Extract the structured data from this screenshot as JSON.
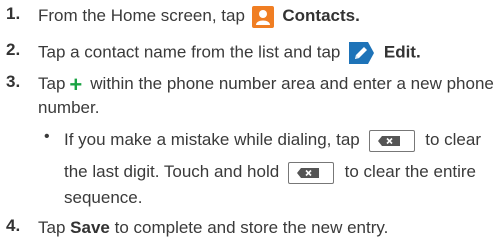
{
  "steps": [
    {
      "number": "1.",
      "text_before": "From the Home screen, tap",
      "bold_label": "Contacts",
      "text_after": "."
    },
    {
      "number": "2.",
      "text_before": "Tap a contact name from the list and tap",
      "bold_label": "Edit",
      "text_after": "."
    },
    {
      "number": "3.",
      "text_before": "Tap",
      "text_after_line1": "within the phone number area and enter a new phone",
      "text_line2": "number."
    },
    {
      "number": "4.",
      "text_before": "Tap",
      "bold_label": "Save",
      "text_after": "to complete and store the new entry."
    }
  ],
  "bullet": {
    "symbol": "•",
    "line1_before": "If you make a mistake while dialing, tap",
    "line1_after": "to clear",
    "line2_before": "the last digit. Touch and hold",
    "line2_after": "to clear the entire",
    "line3": "sequence."
  },
  "icons": {
    "contacts": "contacts-icon",
    "edit": "edit-icon",
    "plus": "+",
    "clear": "backspace-icon"
  },
  "colors": {
    "contacts_icon": "#f07e23",
    "edit_icon": "#1e73b8",
    "plus_icon": "#1aa343"
  }
}
